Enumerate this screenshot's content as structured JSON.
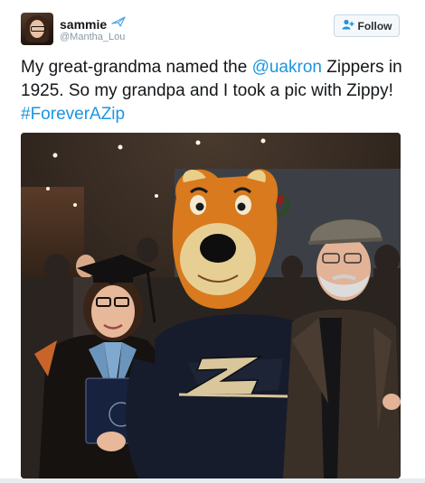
{
  "tweet": {
    "user": {
      "display_name": "sammie",
      "handle": "@Mantha_Lou",
      "name_icon": "airplane-icon"
    },
    "follow_button": {
      "label": "Follow",
      "icon": "add-user-icon"
    },
    "text": {
      "part1": "My great-grandma named the ",
      "mention": "@uakron",
      "part2": " Zippers in 1925. So my grandpa and I took a pic with Zippy! ",
      "hashtag": "#ForeverAZip"
    },
    "photo": {
      "subject": "graduate, mascot Zippy and grandpa posing at a ceremony"
    }
  },
  "colors": {
    "link": "#1b95e0",
    "text": "#14171a",
    "muted": "#8899a6",
    "button_bg": "#f5f8fa"
  }
}
